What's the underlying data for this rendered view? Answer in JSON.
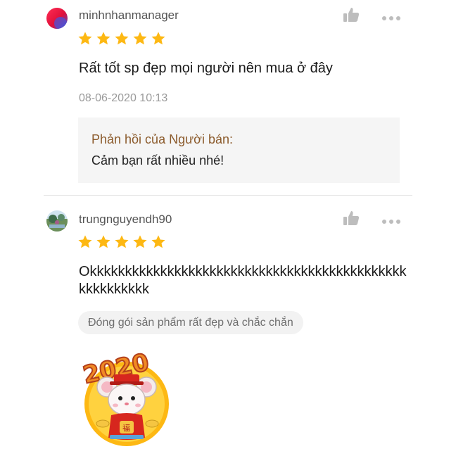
{
  "reviews": [
    {
      "username": "minhnhanmanager",
      "rating": 5,
      "comment": "Rất tốt sp đẹp mọi người nên mua ở đây",
      "timestamp": "08-06-2020 10:13",
      "seller_reply": {
        "title": "Phản hồi của Người bán:",
        "text": "Cảm bạn rất nhiều nhé!"
      },
      "avatar_icon": "avatar-gradient-icon"
    },
    {
      "username": "trungnguyendh90",
      "rating": 5,
      "comment": "Okkkkkkkkkkkkkkkkkkkkkkkkkkkkkkkkkkkkkkkkkkkkkkkkkkkkkkk",
      "tag": "Đóng gói sản phẩm rất đẹp và chắc chắn",
      "sticker_text": "2020",
      "avatar_icon": "avatar-landscape-icon"
    }
  ],
  "icons": {
    "like": "thumbs-up-icon",
    "more": "more-options-icon",
    "star": "star-icon"
  },
  "colors": {
    "star": "#FDB813",
    "icon_gray": "#BDBDBD",
    "seller_title": "#8B5A2B",
    "timestamp": "#9A9A9A"
  }
}
